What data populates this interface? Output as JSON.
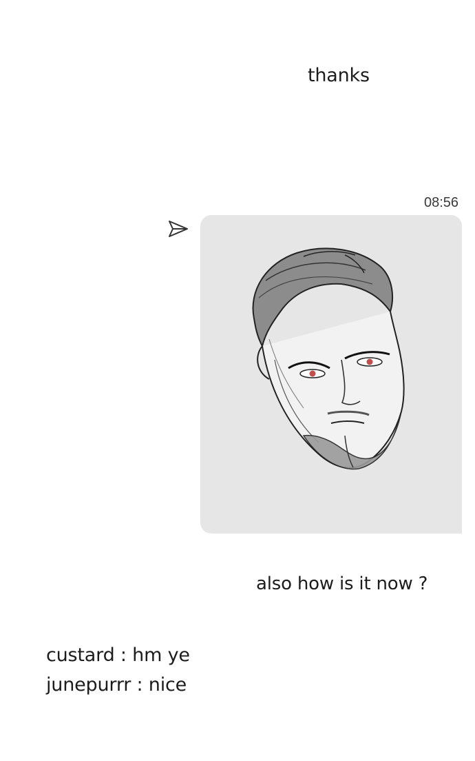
{
  "messages": {
    "thanks": "thanks",
    "timestamp": "08:56",
    "followup": "also how is it now ?"
  },
  "image_attachment": {
    "icon": "portrait-sketch",
    "background": "#e6e6e6"
  },
  "send_icon": "send-arrow-icon",
  "chat_log": [
    {
      "text": "custard : hm ye"
    },
    {
      "text": "junepurrr : nice"
    }
  ],
  "colors": {
    "background": "#ffffff",
    "text": "#1c1c1c",
    "eye_accent": "#c0504d"
  }
}
